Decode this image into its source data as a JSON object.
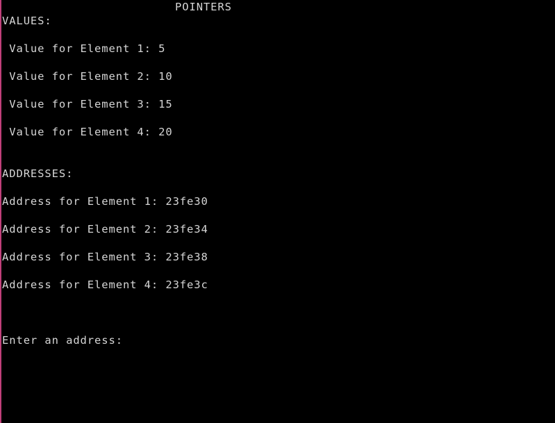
{
  "console": {
    "title": "POINTERS",
    "values_header": "VALUES:",
    "values": [
      " Value for Element 1: 5",
      " Value for Element 2: 10",
      " Value for Element 3: 15",
      " Value for Element 4: 20"
    ],
    "addresses_header": "ADDRESSES:",
    "addresses": [
      "Address for Element 1: 23fe30",
      "Address for Element 2: 23fe34",
      "Address for Element 3: 23fe38",
      "Address for Element 4: 23fe3c"
    ],
    "prompt": "Enter an address:",
    "input_value": ""
  },
  "colors": {
    "background": "#000000",
    "text": "#d6d6d6",
    "left_border": "#c0407a"
  }
}
